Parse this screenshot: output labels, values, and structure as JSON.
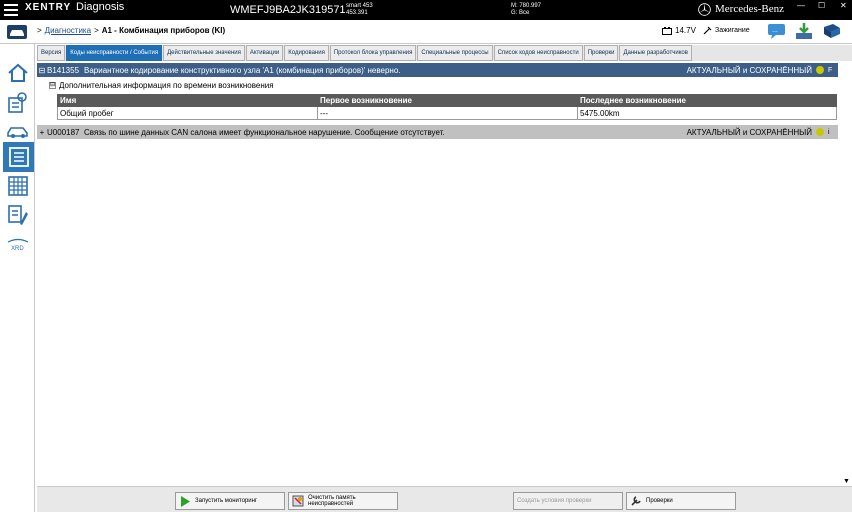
{
  "titlebar": {
    "logo": "XENTRY",
    "app_sub": "Diagnosis",
    "vin": "WMEFJ9BA2JK319571",
    "model_line1": "smart 453",
    "model_line2": "453.391",
    "m_line": "M: 780.997",
    "g_line": "G: Все",
    "brand": "Mercedes-Benz",
    "min": "—",
    "max": "☐",
    "close": "✕"
  },
  "header": {
    "breadcrumb_sep": ">",
    "breadcrumb_link": "Диагностика",
    "breadcrumb_current": "A1 - Комбинация приборов (KI)",
    "voltage": "14.7V",
    "ignition": "Зажигание"
  },
  "tabs": [
    {
      "label": "Версия"
    },
    {
      "label": "Коды неисправности / События"
    },
    {
      "label": "Действительные значения"
    },
    {
      "label": "Активации"
    },
    {
      "label": "Кодирования"
    },
    {
      "label": "Протокол блока управления"
    },
    {
      "label": "Специальные процессы"
    },
    {
      "label": "Список кодов неисправности"
    },
    {
      "label": "Проверки"
    },
    {
      "label": "Данные разработчиков"
    }
  ],
  "faults": [
    {
      "toggle": "⊟",
      "code": "B141355",
      "description": "Вариантное кодирование конструктивного узла 'A1 (комбинация приборов)' неверно.",
      "status": "АКТУАЛЬНЫЙ и СОХРАНЁННЫЙ",
      "status_color": "#c8c800",
      "end": "F"
    },
    {
      "toggle": "+",
      "code": "U000187",
      "description": "Связь по шине данных CAN салона имеет функциональное нарушение. Сообщение отсутствует.",
      "status": "АКТУАЛЬНЫЙ и СОХРАНЁННЫЙ",
      "status_color": "#c8c800",
      "end": "i"
    }
  ],
  "subsection": {
    "toggle": "⊟",
    "title": "Дополнительная информация по времени возникновения"
  },
  "table": {
    "headers": [
      "Имя",
      "Первое возникновение",
      "Последнее возникновение"
    ],
    "rows": [
      [
        "Общий пробег",
        "---",
        "5475.00km"
      ]
    ]
  },
  "bottom_buttons": [
    {
      "label": "Запустить мониторинг",
      "icon": "play-icon",
      "enabled": true
    },
    {
      "label": "Очистить память неисправностей",
      "icon": "clear-memory-icon",
      "enabled": true
    },
    {
      "label": "Создать условия проверки",
      "icon": "",
      "enabled": false
    },
    {
      "label": "Проверки",
      "icon": "wrench-icon",
      "enabled": true
    }
  ],
  "sidebar_items": [
    {
      "name": "home",
      "active": false
    },
    {
      "name": "diagnosis-person",
      "active": false
    },
    {
      "name": "vehicle",
      "active": false
    },
    {
      "name": "list",
      "active": true
    },
    {
      "name": "grid",
      "active": false
    },
    {
      "name": "documents",
      "active": false
    },
    {
      "name": "xrd",
      "active": false,
      "label": "XRD"
    }
  ],
  "colors": {
    "accent": "#1e6fb5",
    "fault_active_bg": "#3d5f87",
    "fault_inactive_bg": "#c0c0c0"
  }
}
